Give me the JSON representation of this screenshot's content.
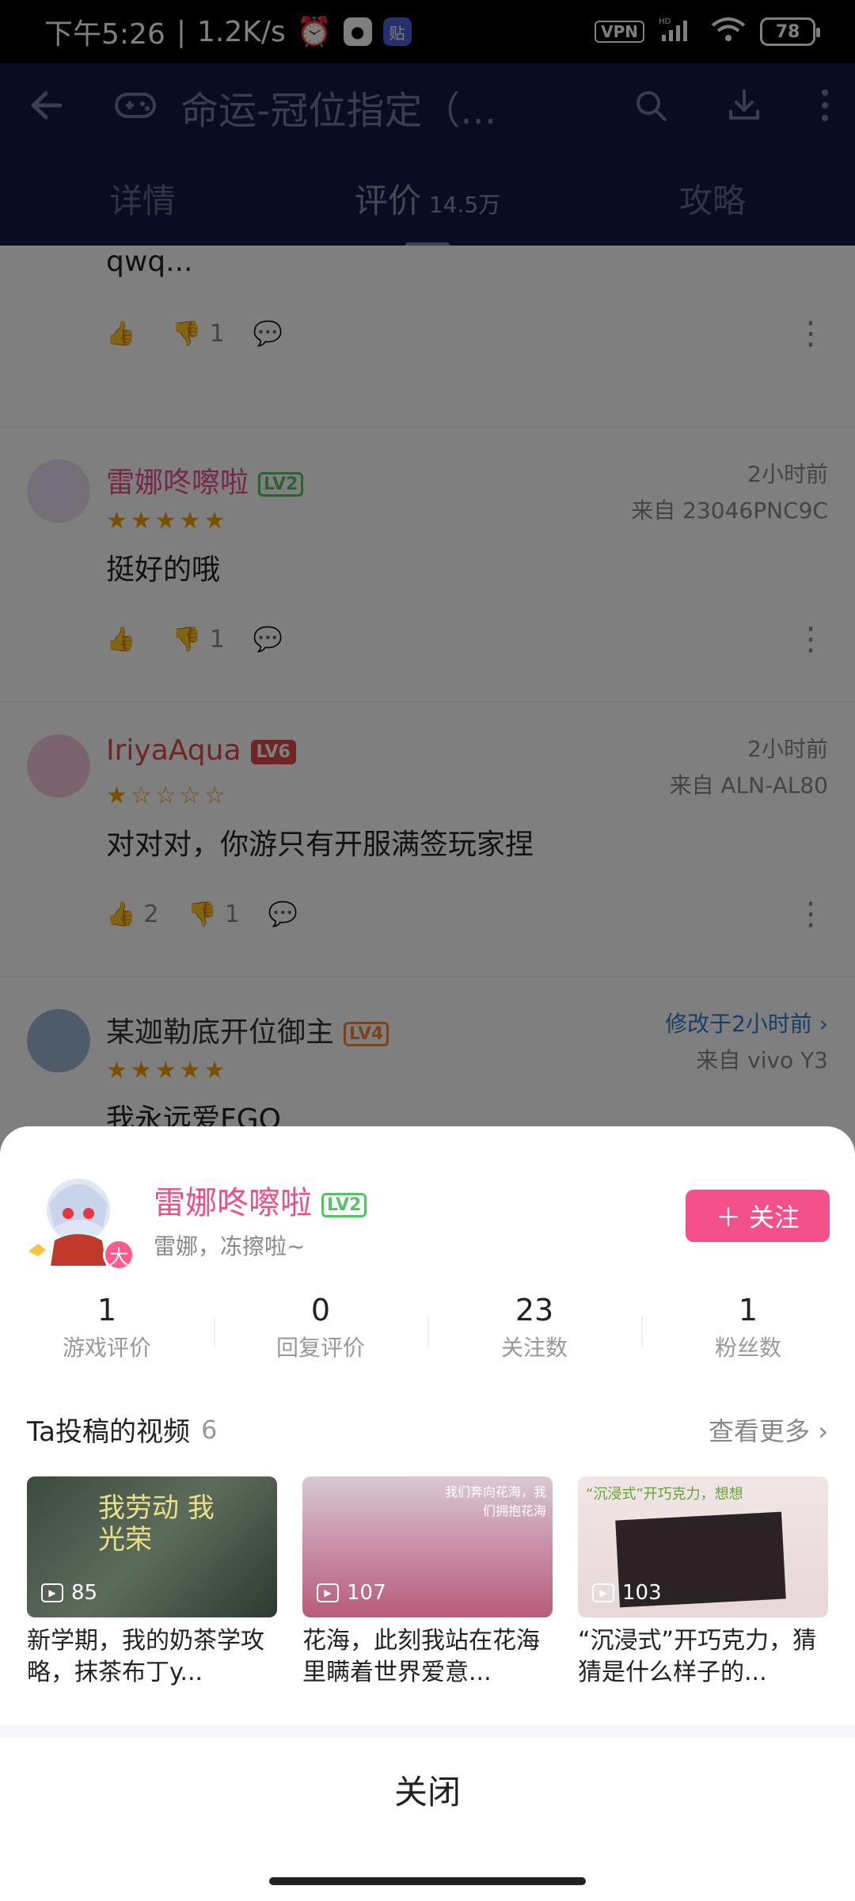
{
  "status_bar": {
    "time": "下午5:26",
    "speed": "1.2K/s",
    "vpn": "VPN",
    "hd": "HD",
    "battery": "78"
  },
  "header": {
    "title": "命运-冠位指定（...",
    "tabs": [
      {
        "label": "详情"
      },
      {
        "label": "评价",
        "count": "14.5万"
      },
      {
        "label": "攻略"
      }
    ]
  },
  "reviews": [
    {
      "text": "qwq...",
      "likes": "",
      "dislikes": "1"
    },
    {
      "user": "雷娜咚嚓啦",
      "level": "LV2",
      "stars": "★★★★★",
      "time": "2小时前",
      "device": "来自 23046PNC9C",
      "text": "挺好的哦",
      "likes": "",
      "dislikes": "1"
    },
    {
      "user": "IriyaAqua",
      "level": "LV6",
      "stars": "★☆☆☆☆",
      "time": "2小时前",
      "device": "来自 ALN-AL80",
      "text": "对对对，你游只有开服满签玩家捏",
      "likes": "2",
      "dislikes": "1"
    },
    {
      "user": "某迦勒底开位御主",
      "level": "LV4",
      "stars": "★★★★★",
      "time": "修改于2小时前 ›",
      "device": "来自 vivo Y3",
      "text": "我永远爱FGO"
    }
  ],
  "profile": {
    "name": "雷娜咚嚓啦",
    "level": "LV2",
    "bio": "雷娜，冻擦啦~",
    "badge": "大",
    "follow_label": "关注",
    "stats": [
      {
        "num": "1",
        "label": "游戏评价"
      },
      {
        "num": "0",
        "label": "回复评价"
      },
      {
        "num": "23",
        "label": "关注数"
      },
      {
        "num": "1",
        "label": "粉丝数"
      }
    ],
    "videos_title": "Ta投稿的视频",
    "videos_count": "6",
    "see_more": "查看更多 ›",
    "videos": [
      {
        "views": "85",
        "title": "新学期，我的奶茶学攻略，抹茶布丁y...",
        "overlay": "我劳动 我光荣"
      },
      {
        "views": "107",
        "title": "花海，此刻我站在花海里瞒着世界爱意...",
        "overlay": "我们奔向花海，我们拥抱花海"
      },
      {
        "views": "103",
        "title": "“沉浸式”开巧克力，猜猜是什么样子的...",
        "overlay": "“沉浸式”开巧克力，想想"
      }
    ],
    "close_label": "关闭"
  }
}
